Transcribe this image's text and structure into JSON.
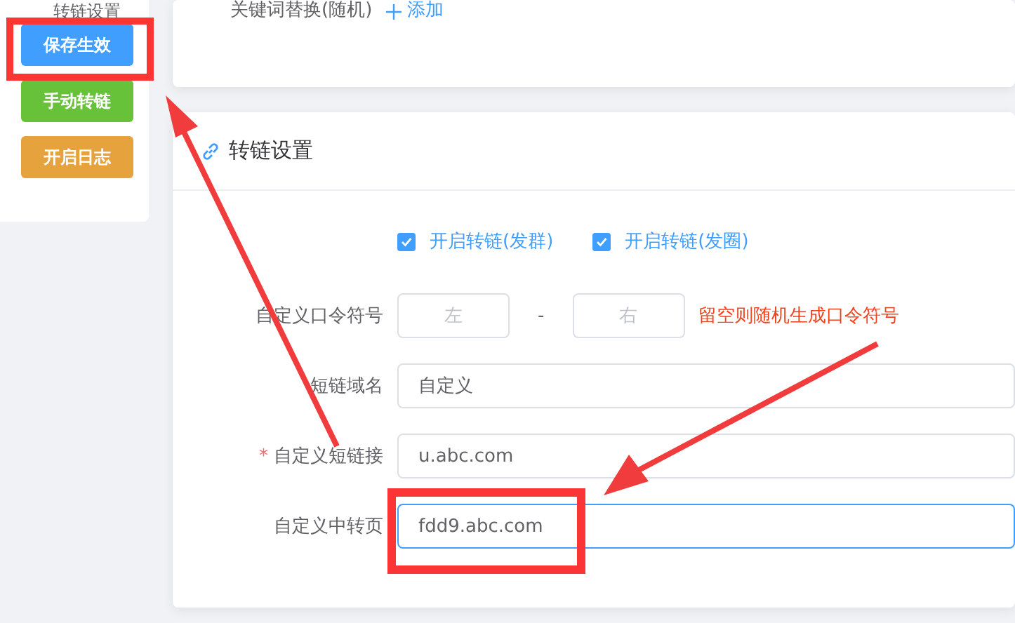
{
  "sidebar": {
    "title": "转链设置",
    "buttons": [
      {
        "label": "保存生效",
        "kind": "primary"
      },
      {
        "label": "手动转链",
        "kind": "success"
      },
      {
        "label": "开启日志",
        "kind": "warning"
      }
    ]
  },
  "top_card": {
    "label": "关键词替换(随机)",
    "add_link": "添加"
  },
  "card": {
    "title": "转链设置",
    "checkboxes": [
      {
        "label": "开启转链(发群)",
        "checked": true
      },
      {
        "label": "开启转链(发圈)",
        "checked": true
      }
    ],
    "fields": [
      {
        "kind": "pair",
        "label": "自定义口令符号",
        "left_placeholder": "左",
        "separator": "-",
        "right_placeholder": "右",
        "hint": "留空则随机生成口令符号"
      },
      {
        "kind": "select",
        "label": "短链域名",
        "value": "自定义"
      },
      {
        "kind": "input",
        "label": "自定义短链接",
        "required_mark": "*",
        "value": "u.abc.com",
        "focused": false
      },
      {
        "kind": "input",
        "label": "自定义中转页",
        "value": "fdd9.abc.com",
        "focused": true
      }
    ]
  }
}
